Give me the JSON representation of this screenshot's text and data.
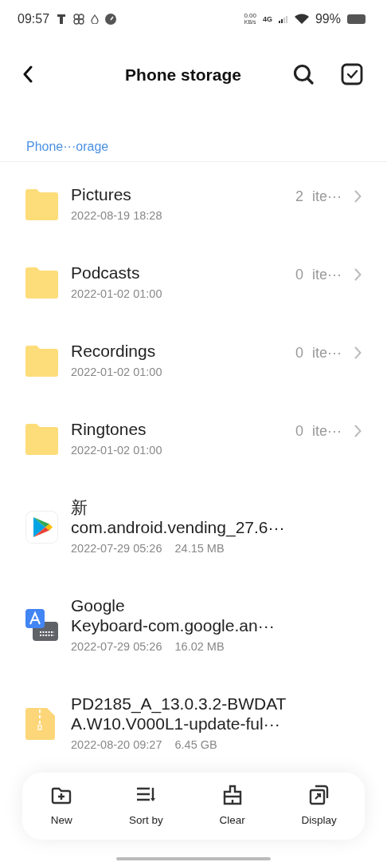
{
  "status_bar": {
    "time": "09:57",
    "speed_value": "0.00",
    "speed_unit": "KB/s",
    "network": "4G",
    "battery": "99%"
  },
  "header": {
    "title": "Phone storage"
  },
  "breadcrumb": "Phone···orage",
  "items": [
    {
      "kind": "folder",
      "name": "Pictures",
      "date": "2022-08-19 18:28",
      "count": "2",
      "unit": "ite···"
    },
    {
      "kind": "folder",
      "name": "Podcasts",
      "date": "2022-01-02 01:00",
      "count": "0",
      "unit": "ite···"
    },
    {
      "kind": "folder",
      "name": "Recordings",
      "date": "2022-01-02 01:00",
      "count": "0",
      "unit": "ite···"
    },
    {
      "kind": "folder",
      "name": "Ringtones",
      "date": "2022-01-02 01:00",
      "count": "0",
      "unit": "ite···"
    },
    {
      "kind": "play",
      "name_lines": [
        "新",
        "com.android.vending_27.6···"
      ],
      "date": "2022-07-29 05:26",
      "size": "24.15 MB"
    },
    {
      "kind": "keyboard",
      "name_lines": [
        "Google",
        "Keyboard-com.google.an···"
      ],
      "date": "2022-07-29 05:26",
      "size": "16.02 MB"
    },
    {
      "kind": "zip",
      "name_lines": [
        "PD2185_A_13.0.3.2-BWDAT",
        "A.W10.V000L1-update-ful···"
      ],
      "date": "2022-08-20 09:27",
      "size": "6.45 GB"
    }
  ],
  "toolbar": [
    {
      "kind": "new",
      "label": "New"
    },
    {
      "kind": "sort",
      "label": "Sort by"
    },
    {
      "kind": "clear",
      "label": "Clear"
    },
    {
      "kind": "display",
      "label": "Display"
    }
  ]
}
